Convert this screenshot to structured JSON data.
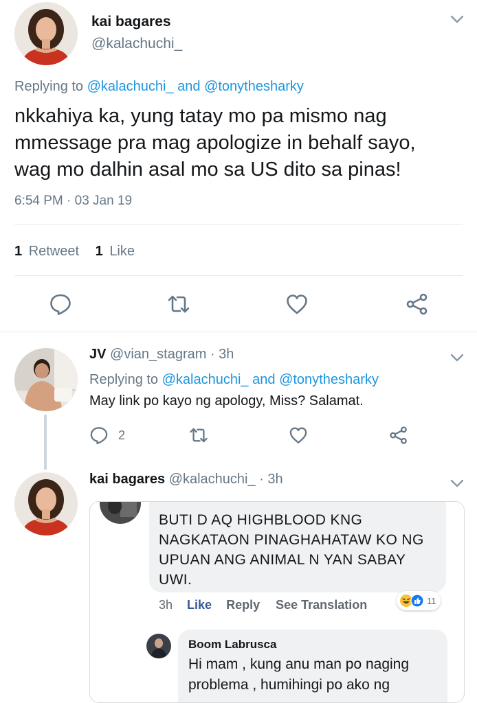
{
  "main_tweet": {
    "author_name": "kai bagares",
    "author_handle": "@kalachuchi_",
    "replying_prefix": "Replying to",
    "replying_user1": "@kalachuchi_",
    "replying_and": "and",
    "replying_user2": "@tonythesharky",
    "text_line1": "nkkahiya ka, yung tatay mo pa mismo nag",
    "text_line2": "mmessage pra mag apologize in behalf sayo,",
    "text_line3": "wag mo dalhin asal mo sa US dito sa pinas!",
    "timestamp": "6:54 PM · 03 Jan 19",
    "retweet_count": "1",
    "retweet_label": "Retweet",
    "like_count": "1",
    "like_label": "Like"
  },
  "reply1": {
    "author_name": "JV",
    "author_handle": "@vian_stagram",
    "time": "· 3h",
    "replying_prefix": "Replying to",
    "replying_user1": "@kalachuchi_",
    "replying_and": "and",
    "replying_user2": "@tonythesharky",
    "text": "May link po kayo ng apology, Miss? Salamat.",
    "reply_count": "2"
  },
  "reply2": {
    "author_name": "kai bagares",
    "author_handle": "@kalachuchi_",
    "time": "· 3h"
  },
  "embedded_fb": {
    "comment_line1": "BUTI D AQ HIGHBLOOD KNG",
    "comment_line2": "NAGKATAON PINAGHAHATAW KO NG",
    "comment_line3": "UPUAN ANG ANIMAL N YAN SABAY",
    "comment_line4": "UWI.",
    "meta_time": "3h",
    "meta_like": "Like",
    "meta_reply": "Reply",
    "meta_translation": "See Translation",
    "reaction_count": "11",
    "reply_author": "Boom Labrusca",
    "reply_line1": "Hi mam , kung anu man po naging",
    "reply_line2": "problema , humihingi po ako ng"
  },
  "colors": {
    "link": "#1b95e0",
    "muted": "#657786",
    "divider": "#e1e8ed",
    "fb_like": "#385898"
  },
  "icons": [
    "chevron-down-icon",
    "reply-icon",
    "retweet-icon",
    "like-icon",
    "share-icon",
    "haha-reaction-icon",
    "like-reaction-icon"
  ]
}
